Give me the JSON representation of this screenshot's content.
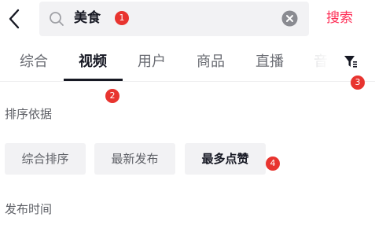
{
  "header": {
    "search_value": "美食",
    "search_button_label": "搜索"
  },
  "tabs": [
    {
      "label": "综合"
    },
    {
      "label": "视频"
    },
    {
      "label": "用户"
    },
    {
      "label": "商品"
    },
    {
      "label": "直播"
    },
    {
      "label": "音"
    }
  ],
  "active_tab": "视频",
  "filters": {
    "sort_title": "排序依据",
    "sort_options": [
      {
        "label": "综合排序"
      },
      {
        "label": "最新发布"
      },
      {
        "label": "最多点赞"
      }
    ],
    "selected_sort": "最多点赞",
    "time_title": "发布时间"
  },
  "markers": [
    "1",
    "2",
    "3",
    "4"
  ],
  "colors": {
    "accent": "#fe2c55",
    "marker": "#e8342f",
    "chip_bg": "#f2f2f4",
    "search_bg": "#f2f2f4"
  },
  "icons": {
    "back": "back-arrow-icon",
    "search": "search-icon",
    "clear": "clear-icon",
    "filter": "filter-icon"
  }
}
